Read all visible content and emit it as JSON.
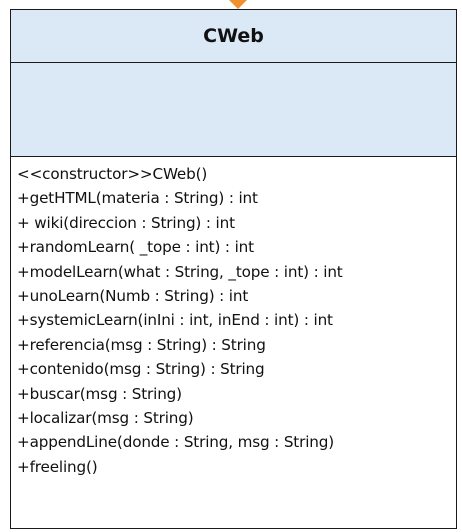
{
  "diagram": {
    "class_name": "CWeb",
    "operations": [
      "<<constructor>>CWeb()",
      "+getHTML(materia : String) : int",
      "+ wiki(direccion : String) : int",
      "+randomLearn( _tope : int) : int",
      "+modelLearn(what : String, _tope : int) : int",
      "+unoLearn(Numb : String) : int",
      "+systemicLearn(inIni : int, inEnd : int) : int",
      "+referencia(msg : String) : String",
      "+contenido(msg : String) : String",
      "+buscar(msg : String)",
      "+localizar(msg : String)",
      "+appendLine(donde : String, msg : String)",
      "+freeling()"
    ]
  }
}
